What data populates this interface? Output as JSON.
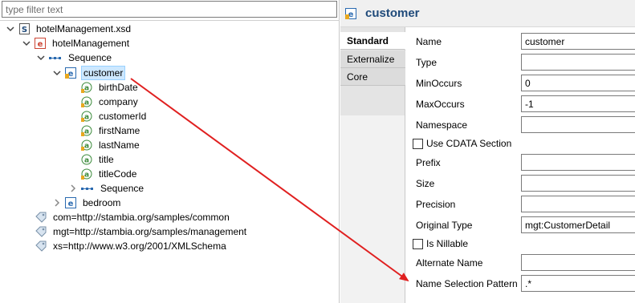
{
  "filter": {
    "placeholder": "type filter text"
  },
  "tree": {
    "rows": [
      {
        "label": "hotelManagement.xsd",
        "icon": "xsd-file-icon"
      },
      {
        "label": "hotelManagement",
        "icon": "root-element-icon"
      },
      {
        "label": "Sequence",
        "icon": "sequence-icon"
      },
      {
        "label": "customer",
        "icon": "element-icon"
      },
      {
        "label": "birthDate",
        "icon": "attribute-icon"
      },
      {
        "label": "company",
        "icon": "attribute-icon"
      },
      {
        "label": "customerId",
        "icon": "attribute-icon"
      },
      {
        "label": "firstName",
        "icon": "attribute-icon"
      },
      {
        "label": "lastName",
        "icon": "attribute-icon"
      },
      {
        "label": "title",
        "icon": "attribute-icon"
      },
      {
        "label": "titleCode",
        "icon": "attribute-icon"
      },
      {
        "label": "Sequence",
        "icon": "sequence-icon"
      },
      {
        "label": "bedroom",
        "icon": "element-icon"
      },
      {
        "label": "com=http://stambia.org/samples/common",
        "icon": "namespace-icon"
      },
      {
        "label": "mgt=http://stambia.org/samples/management",
        "icon": "namespace-icon"
      },
      {
        "label": "xs=http://www.w3.org/2001/XMLSchema",
        "icon": "namespace-icon"
      }
    ]
  },
  "properties": {
    "title": "customer",
    "tabs": [
      "Standard",
      "Externalize",
      "Core"
    ],
    "fields": {
      "name": {
        "label": "Name",
        "value": "customer"
      },
      "type": {
        "label": "Type",
        "value": ""
      },
      "min_occurs": {
        "label": "MinOccurs",
        "value": "0"
      },
      "max_occurs": {
        "label": "MaxOccurs",
        "value": "-1"
      },
      "namespace": {
        "label": "Namespace",
        "value": ""
      },
      "cdata": {
        "label": "Use CDATA Section",
        "checked": false
      },
      "prefix": {
        "label": "Prefix",
        "value": ""
      },
      "size": {
        "label": "Size",
        "value": ""
      },
      "precision": {
        "label": "Precision",
        "value": ""
      },
      "original_type": {
        "label": "Original Type",
        "value": "mgt:CustomerDetail"
      },
      "nillable": {
        "label": "Is Nillable",
        "checked": false
      },
      "alternate_name": {
        "label": "Alternate Name",
        "value": ""
      },
      "name_selection_pattern": {
        "label": "Name Selection Pattern",
        "value": ".*"
      }
    }
  },
  "colors": {
    "annotation_arrow": "#e02020",
    "selection": "#cde8ff",
    "title": "#1f4a7a"
  }
}
